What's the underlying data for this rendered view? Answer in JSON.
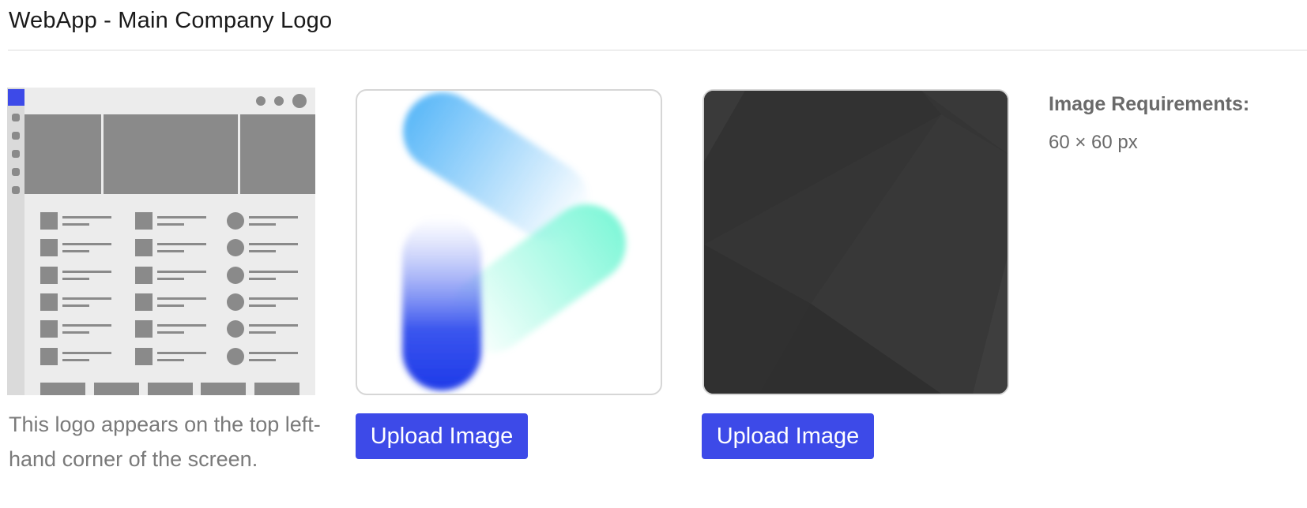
{
  "section": {
    "title": "WebApp - Main Company Logo"
  },
  "preview": {
    "description": "This logo appears on the top left-hand corner of the screen.",
    "accent_color": "#3d4ae8",
    "wireframe_color": "#8a8a8a"
  },
  "logo_light": {
    "background": "#ffffff",
    "colors": [
      "#5bb8f8",
      "#7ff7d8",
      "#1e3ae8"
    ],
    "upload_label": "Upload Image"
  },
  "logo_dark": {
    "background": "#353535",
    "upload_label": "Upload Image"
  },
  "requirements": {
    "title": "Image Requirements:",
    "value": "60 × 60 px"
  },
  "colors": {
    "button": "#3d4ae8",
    "button_text": "#ffffff",
    "muted_text": "#7a7a7a"
  }
}
